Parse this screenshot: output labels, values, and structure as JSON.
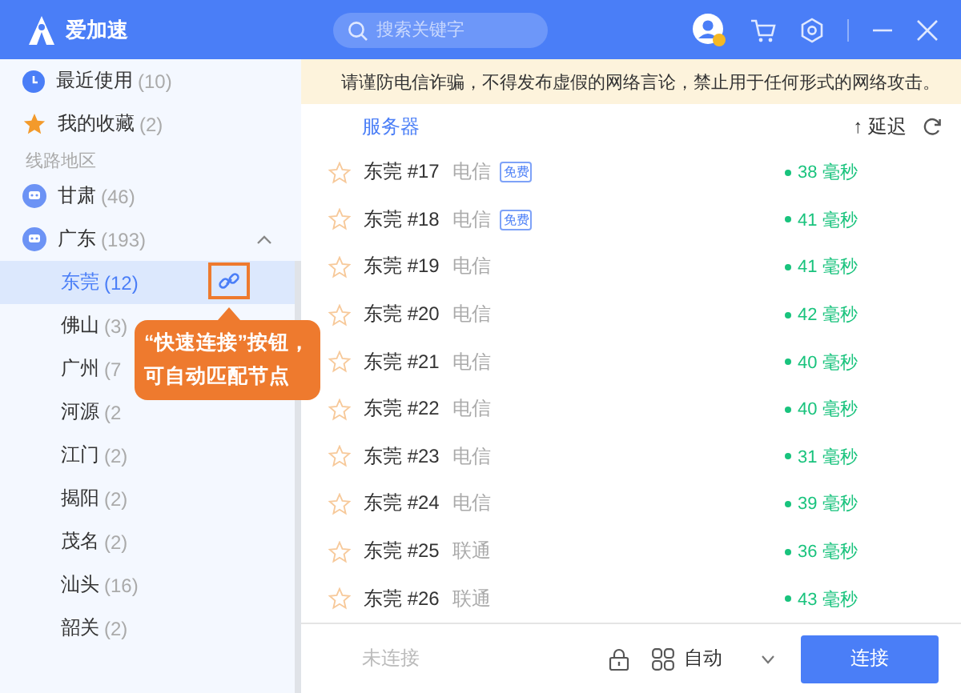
{
  "app": {
    "name": "爱加速",
    "search_placeholder": "搜索关键字"
  },
  "notice": {
    "text": "请谨防电信诈骗，不得发布虚假的网络言论，禁止用于任何形式的网络攻击。"
  },
  "sidebar": {
    "quick": [
      {
        "kind": "recent",
        "label": "最近使用",
        "count": "(10)"
      },
      {
        "kind": "favorite",
        "label": "我的收藏",
        "count": "(2)"
      }
    ],
    "section": "线路地区",
    "regions": [
      {
        "label": "甘肃",
        "count": "(46)"
      },
      {
        "label": "广东",
        "count": "(193)",
        "expanded": true,
        "children": [
          {
            "label": "东莞",
            "count": "(12)",
            "selected": true
          },
          {
            "label": "佛山",
            "count": "(3)",
            "selected": false
          },
          {
            "label": "广州",
            "count": "(7",
            "selected": false
          },
          {
            "label": "河源",
            "count": "(2",
            "selected": false
          },
          {
            "label": "江门",
            "count": "(2)",
            "selected": false
          },
          {
            "label": "揭阳",
            "count": "(2)",
            "selected": false
          },
          {
            "label": "茂名",
            "count": "(2)",
            "selected": false
          },
          {
            "label": "汕头",
            "count": "(16)",
            "selected": false
          },
          {
            "label": "韶关",
            "count": "(2)",
            "selected": false
          }
        ]
      }
    ]
  },
  "callout": {
    "lines": [
      "“快速连接”按钮，",
      "可自动匹配节点"
    ]
  },
  "table": {
    "server_header": "服务器",
    "sort_arrow": "↑",
    "latency_header": "延迟",
    "rows": [
      {
        "name": "东莞 #17",
        "isp": "电信",
        "tag": "免费",
        "latency": "38 毫秒",
        "favorite": false
      },
      {
        "name": "东莞 #18",
        "isp": "电信",
        "tag": "免费",
        "latency": "41 毫秒",
        "favorite": false
      },
      {
        "name": "东莞 #19",
        "isp": "电信",
        "latency": "41 毫秒",
        "favorite": false
      },
      {
        "name": "东莞 #20",
        "isp": "电信",
        "latency": "42 毫秒",
        "favorite": false
      },
      {
        "name": "东莞 #21",
        "isp": "电信",
        "latency": "40 毫秒",
        "favorite": false
      },
      {
        "name": "东莞 #22",
        "isp": "电信",
        "latency": "40 毫秒",
        "favorite": false
      },
      {
        "name": "东莞 #23",
        "isp": "电信",
        "latency": "31 毫秒",
        "favorite": false
      },
      {
        "name": "东莞 #24",
        "isp": "电信",
        "latency": "39 毫秒",
        "favorite": false
      },
      {
        "name": "东莞 #25",
        "isp": "联通",
        "latency": "36 毫秒",
        "favorite": false
      },
      {
        "name": "东莞 #26",
        "isp": "联通",
        "latency": "43 毫秒",
        "favorite": false
      }
    ]
  },
  "footer": {
    "status": "未连接",
    "mode": "自动",
    "connect_button": "连接"
  }
}
